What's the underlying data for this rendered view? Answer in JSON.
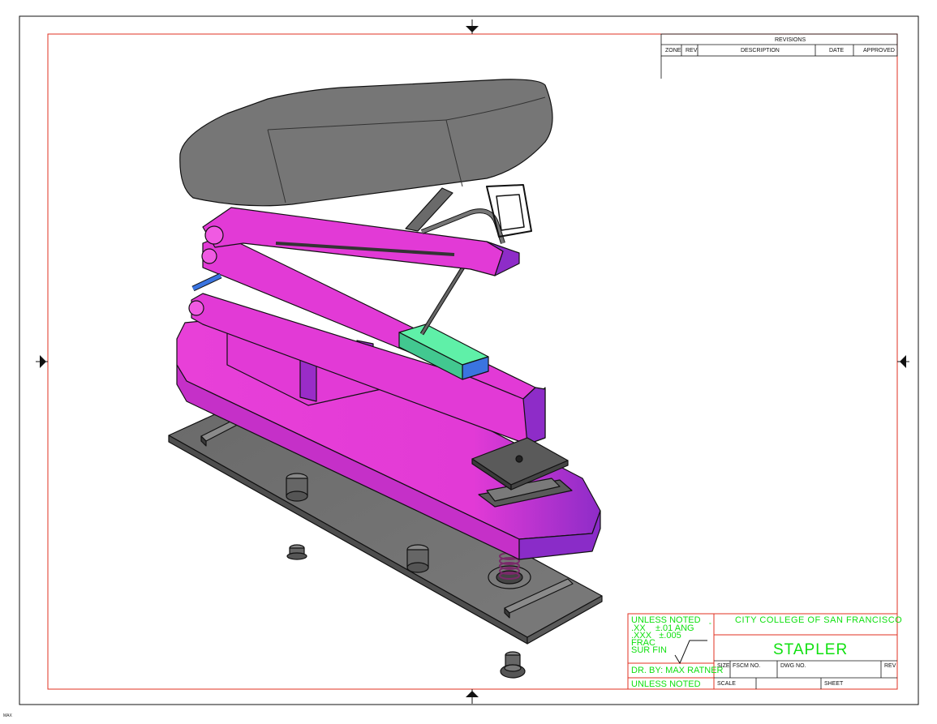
{
  "revisions": {
    "title": "REVISIONS",
    "columns": [
      "ZONE",
      "REV",
      "DESCRIPTION",
      "DATE",
      "APPROVED"
    ]
  },
  "title_block": {
    "tolerances": [
      "UNLESS NOTED",
      ".XX    ±.01 ANG",
      ".XXX   ±.005",
      "FRAC",
      "SUR FIN"
    ],
    "degree_mark": "°",
    "drawn_by": "DR. BY: MAX RATNER",
    "unless_noted": "UNLESS NOTED",
    "school": "CITY COLLEGE OF SAN FRANCISCO",
    "drawing_title": "STAPLER",
    "size_label": "SIZE",
    "fscm_label": "FSCM NO.",
    "dwg_label": "DWG NO.",
    "rev_label": "REV",
    "scale_label": "SCALE",
    "sheet_label": "SHEET"
  },
  "corner_mark": "MAX",
  "colors": {
    "border": "#e03020",
    "magenta": "#e23ad6",
    "magenta_dark": "#9a2cc8",
    "gray": "#767676",
    "gray_dark": "#4e4e4e",
    "green_part": "#5ff0a8",
    "blue_part": "#3a74e0",
    "text_green": "#10e010"
  }
}
